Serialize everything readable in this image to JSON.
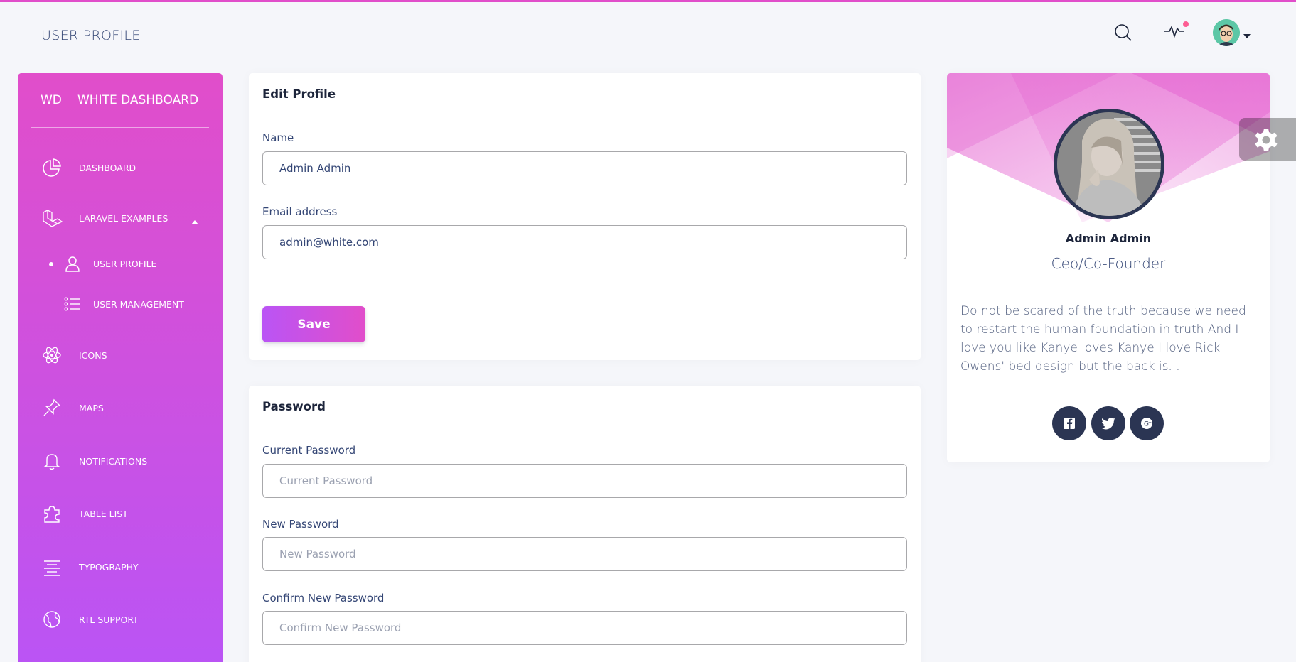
{
  "header": {
    "title": "USER PROFILE",
    "icons": [
      "search-icon",
      "activity-icon",
      "avatar",
      "caret-down-icon"
    ]
  },
  "sidebar": {
    "logo_mini": "WD",
    "logo_text": "WHITE DASHBOARD",
    "items": [
      {
        "label": "DASHBOARD",
        "icon": "chart-pie-icon"
      },
      {
        "label": "LARAVEL EXAMPLES",
        "icon": "laravel-icon"
      },
      {
        "label": "USER PROFILE",
        "icon": "user-icon"
      },
      {
        "label": "USER MANAGEMENT",
        "icon": "list-icon"
      },
      {
        "label": "ICONS",
        "icon": "atom-icon"
      },
      {
        "label": "MAPS",
        "icon": "pin-icon"
      },
      {
        "label": "NOTIFICATIONS",
        "icon": "bell-icon"
      },
      {
        "label": "TABLE LIST",
        "icon": "puzzle-icon"
      },
      {
        "label": "TYPOGRAPHY",
        "icon": "align-center-icon"
      },
      {
        "label": "RTL SUPPORT",
        "icon": "world-icon"
      }
    ]
  },
  "edit_profile": {
    "title": "Edit Profile",
    "name_label": "Name",
    "name_value": "Admin Admin",
    "email_label": "Email address",
    "email_value": "admin@white.com",
    "save_label": "Save"
  },
  "password": {
    "title": "Password",
    "current_label": "Current Password",
    "current_placeholder": "Current Password",
    "new_label": "New Password",
    "new_placeholder": "New Password",
    "confirm_label": "Confirm New Password",
    "confirm_placeholder": "Confirm New Password"
  },
  "profile": {
    "name": "Admin Admin",
    "role": "Ceo/Co-Founder",
    "bio": "Do not be scared of the truth because we need to restart the human foundation in truth And I love you like Kanye loves Kanye I love Rick Owens' bed design but the back is...",
    "socials": [
      "facebook-icon",
      "twitter-icon",
      "google-plus-icon"
    ]
  },
  "colors": {
    "accent_start": "#e14eca",
    "accent_end": "#ba54f5",
    "dark_circle": "#2b3553",
    "notification_dot": "#fd5d93"
  }
}
